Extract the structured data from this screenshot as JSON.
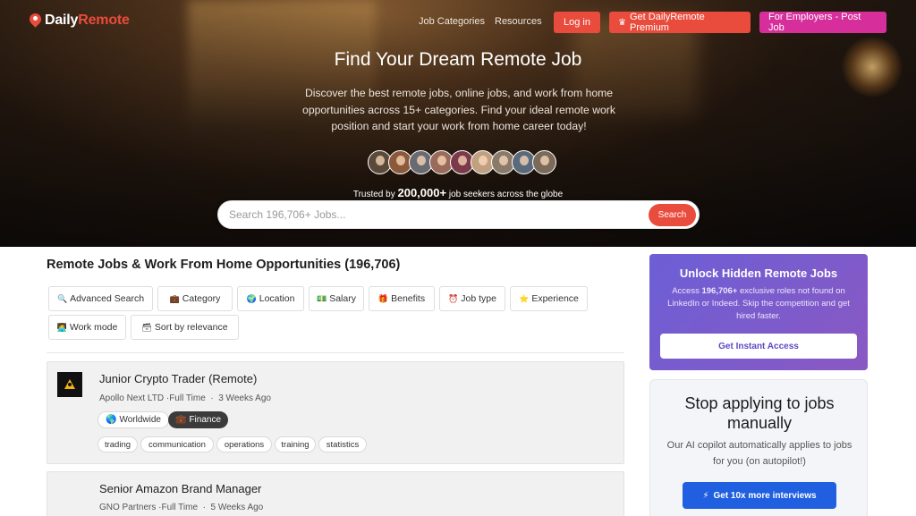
{
  "header": {
    "logo_part1": "Daily",
    "logo_part2": "Remote",
    "nav_links": [
      "Job Categories",
      "Resources"
    ],
    "login_label": "Log in",
    "premium_label": "Get DailyRemote Premium",
    "employers_label": "For Employers - Post Job",
    "colors": {
      "brand_red": "#e94b3c",
      "employers_pink": "#d62f9b"
    }
  },
  "hero": {
    "title": "Find Your Dream Remote Job",
    "subtitle": "Discover the best remote jobs, online jobs, and work from home opportunities across 15+ categories. Find your ideal remote work position and start your work from home career today!",
    "avatar_count": 9,
    "trusted_prefix": "Trusted by",
    "trusted_count": "200,000+",
    "trusted_suffix": "job seekers across the globe"
  },
  "search": {
    "placeholder": "Search 196,706+ Jobs...",
    "value": "",
    "button_label": "Search"
  },
  "main": {
    "heading": "Remote Jobs & Work From Home Opportunities (196,706)",
    "filters": [
      {
        "icon": "🔍",
        "icon_name": "search-icon",
        "label": "Advanced Search"
      },
      {
        "icon": "💼",
        "icon_name": "briefcase-icon",
        "label": "Category"
      },
      {
        "icon": "🌍",
        "icon_name": "globe-icon",
        "label": "Location"
      },
      {
        "icon": "💵",
        "icon_name": "money-icon",
        "label": "Salary"
      },
      {
        "icon": "🎁",
        "icon_name": "gift-icon",
        "label": "Benefits"
      },
      {
        "icon": "⏰",
        "icon_name": "clock-icon",
        "label": "Job type"
      },
      {
        "icon": "⭐",
        "icon_name": "star-icon",
        "label": "Experience"
      },
      {
        "icon": "🧑‍💻",
        "icon_name": "person-icon",
        "label": "Work mode"
      },
      {
        "icon": "🗃",
        "icon_name": "sort-icon",
        "label": "Sort by relevance"
      }
    ],
    "jobs": [
      {
        "title": "Junior Crypto Trader (Remote)",
        "company": "Apollo Next LTD",
        "type": "·Full Time",
        "posted": "3 Weeks Ago",
        "badges": [
          {
            "icon": "🌎",
            "label": "Worldwide"
          },
          {
            "icon": "💼",
            "label": "Finance"
          }
        ],
        "tags": [
          "trading",
          "communication",
          "operations",
          "training",
          "statistics"
        ]
      },
      {
        "title": "Senior Amazon Brand Manager",
        "company": "GNO Partners",
        "type": "·Full Time",
        "posted": "5 Weeks Ago"
      }
    ]
  },
  "sidebar": {
    "promo": {
      "title": "Unlock Hidden Remote Jobs",
      "text_prefix": "Access",
      "text_bold": "196,706+",
      "text_suffix": "exclusive roles not found on LinkedIn or Indeed. Skip the competition and get hired faster.",
      "button_label": "Get Instant Access"
    },
    "copilot": {
      "title": "Stop applying to jobs manually",
      "text": "Our AI copilot automatically applies to jobs for you (on autopilot!)",
      "button_icon": "⚡",
      "button_label": "Get 10x more interviews"
    }
  }
}
